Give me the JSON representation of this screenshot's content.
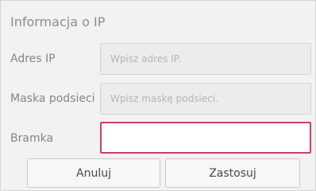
{
  "dialog": {
    "title": "Informacja o IP"
  },
  "fields": [
    {
      "label": "Adres IP",
      "placeholder": "Wpisz adres IP.",
      "value": ""
    },
    {
      "label": "Maska podsieci",
      "placeholder": "Wpisz maskę podsieci.",
      "value": ""
    },
    {
      "label": "Bramka",
      "placeholder": "",
      "value": ""
    }
  ],
  "buttons": {
    "cancel": "Anuluj",
    "apply": "Zastosuj"
  },
  "colors": {
    "focus_border": "#cc3f63"
  }
}
